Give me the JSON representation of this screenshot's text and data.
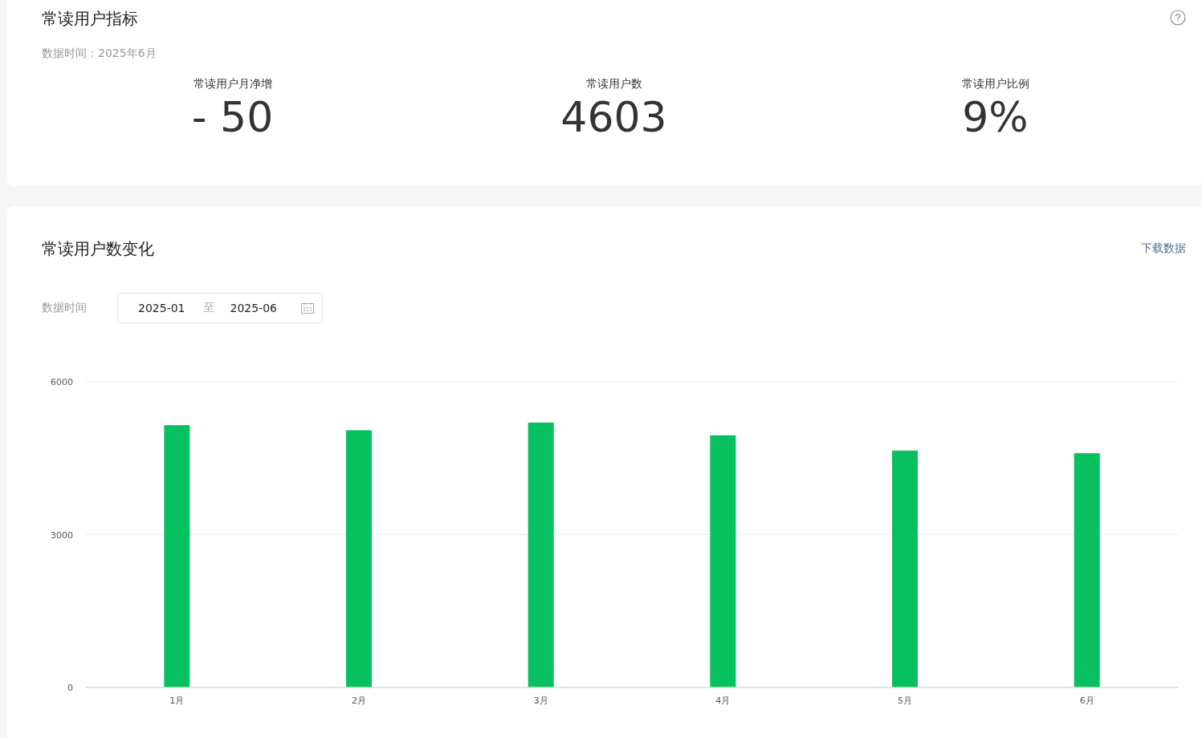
{
  "indicators": {
    "title": "常读用户指标",
    "data_time": "数据时间：2025年6月",
    "metrics": [
      {
        "label": "常读用户月净增",
        "value": "- 50"
      },
      {
        "label": "常读用户数",
        "value": "4603"
      },
      {
        "label": "常读用户比例",
        "value": "9%"
      }
    ]
  },
  "trend": {
    "title": "常读用户数变化",
    "download_link": "下载数据",
    "date_label": "数据时间",
    "date_start": "2025-01",
    "date_separator": "至",
    "date_end": "2025-06",
    "chart_data": {
      "type": "bar",
      "categories": [
        "1月",
        "2月",
        "3月",
        "4月",
        "5月",
        "6月"
      ],
      "series": [
        {
          "color": "#07c160",
          "values": [
            5150,
            5050,
            5200,
            4950,
            4650,
            4600
          ]
        }
      ],
      "ylim": [
        0,
        6000
      ],
      "yticks": [
        0,
        3000,
        6000
      ]
    }
  }
}
